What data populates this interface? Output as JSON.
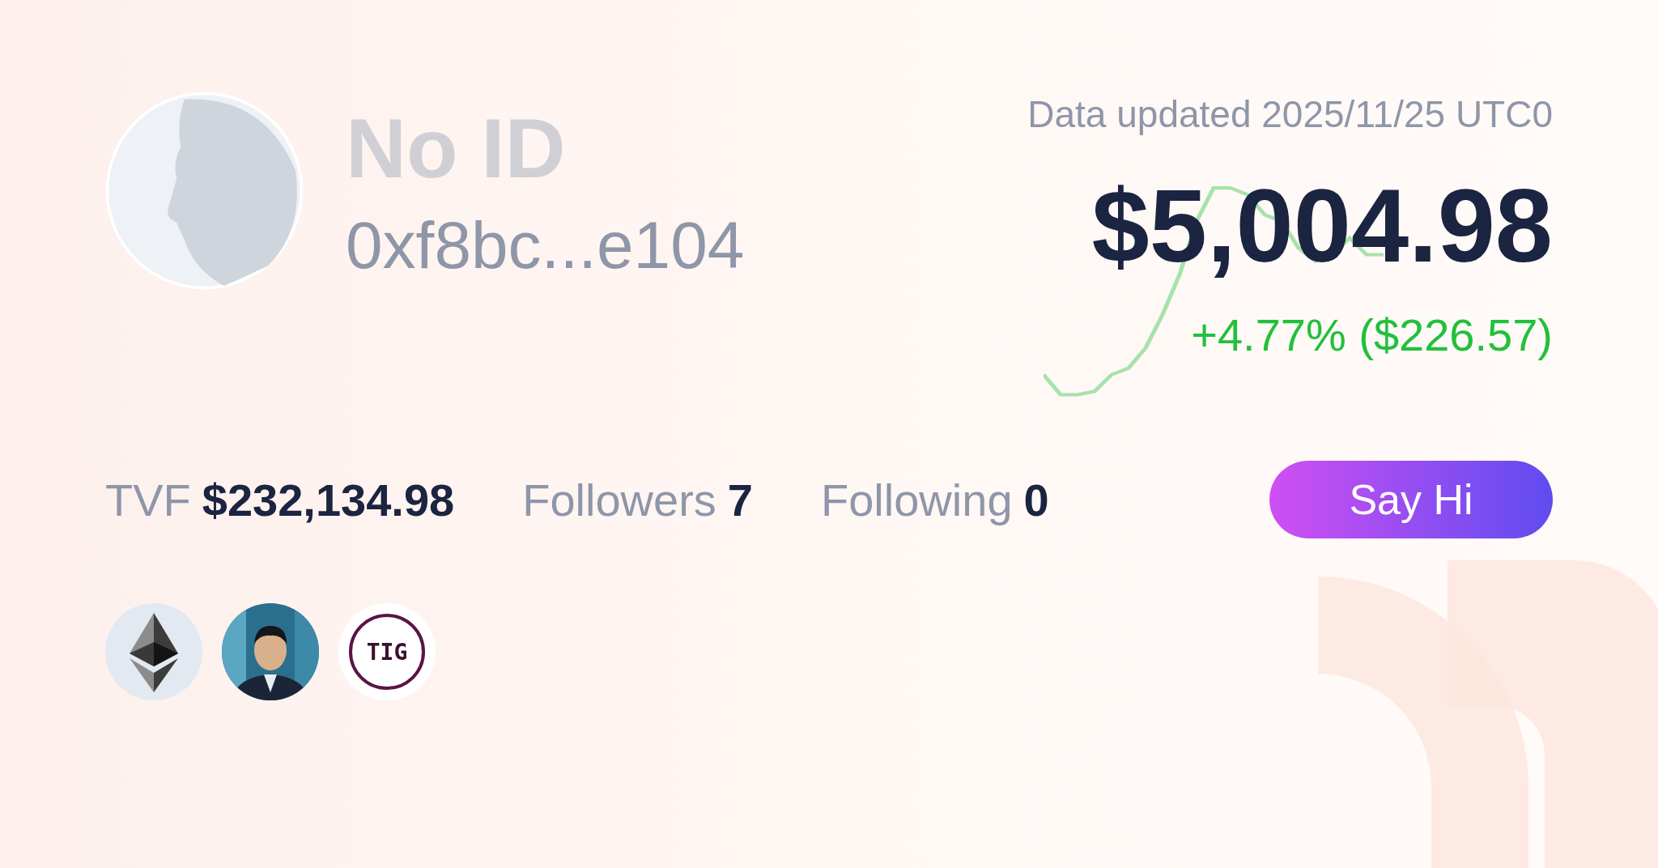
{
  "profile": {
    "name": "No ID",
    "address": "0xf8bc...e104"
  },
  "summary": {
    "updated": "Data updated 2025/11/25 UTC0",
    "balance": "$5,004.98",
    "change": "+4.77% ($226.57)"
  },
  "stats": [
    {
      "label": "TVF",
      "value": "$232,134.98"
    },
    {
      "label": "Followers",
      "value": "7"
    },
    {
      "label": "Following",
      "value": "0"
    }
  ],
  "action": {
    "label": "Say Hi"
  },
  "badges": [
    {
      "kind": "ethereum"
    },
    {
      "kind": "picture"
    },
    {
      "kind": "logo",
      "text": "TIG"
    }
  ]
}
